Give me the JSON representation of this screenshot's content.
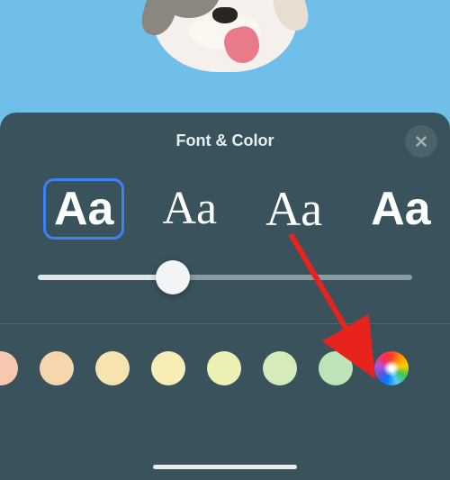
{
  "panel": {
    "title": "Font & Color"
  },
  "fonts": {
    "sample": "Aa",
    "selected_index": 0
  },
  "slider": {
    "value_percent": 36
  },
  "colors": {
    "swatches": [
      "#F6C8B0",
      "#F6D6AD",
      "#F7E3B0",
      "#F6EEB4",
      "#EDF0B5",
      "#D6EBBA",
      "#BFE3B8"
    ]
  }
}
